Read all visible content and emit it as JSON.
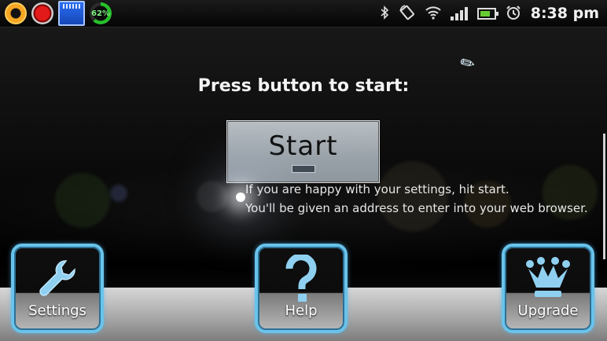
{
  "status_bar": {
    "battery_percent_label": "62%",
    "time": "8:38 pm",
    "left_icons": [
      "orange-app-icon",
      "record-icon",
      "sd-card-icon",
      "battery-circle-icon"
    ],
    "right_icons": [
      "bluetooth-icon",
      "rotate-icon",
      "wifi-icon",
      "signal-icon",
      "battery-icon",
      "alarm-clock-icon"
    ]
  },
  "main": {
    "headline": "Press button to start:",
    "start_button": "Start",
    "info_line1": "If you are happy with your settings, hit start.",
    "info_line2": "You'll be given an address to enter into your web browser."
  },
  "toolbar": {
    "settings_label": "Settings",
    "help_label": "Help",
    "upgrade_label": "Upgrade"
  },
  "colors": {
    "accent_border": "#69c3ea",
    "icon_blue": "#8fd0f0"
  }
}
